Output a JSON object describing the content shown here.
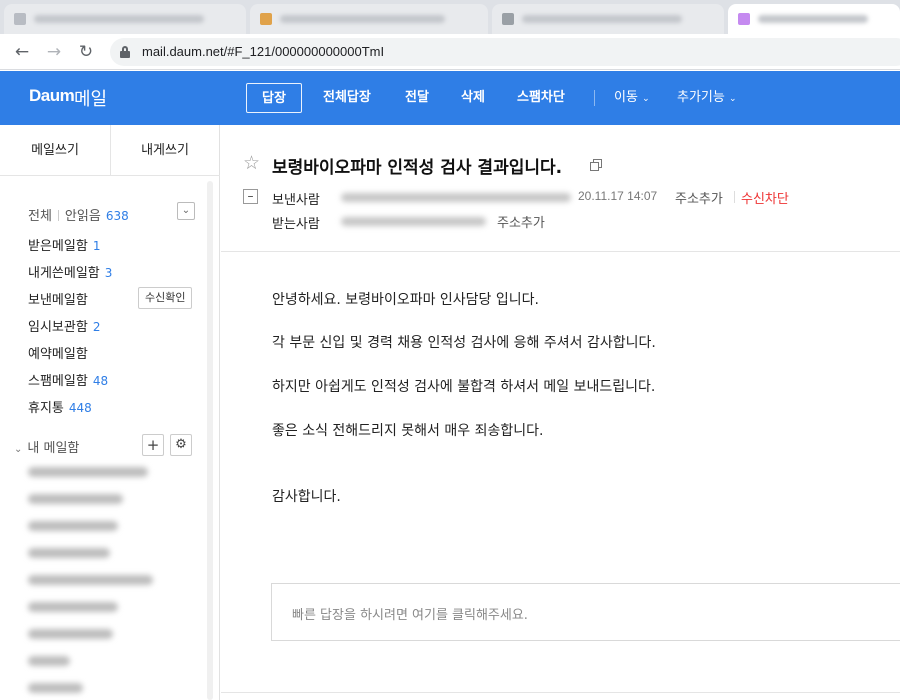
{
  "browser": {
    "url": "mail.daum.net/#F_121/000000000000TmI"
  },
  "app": {
    "logo": "Daum",
    "service": "메일",
    "brand_color": "#2f7ee6"
  },
  "toolbar": {
    "reply": "답장",
    "reply_all": "전체답장",
    "forward": "전달",
    "delete": "삭제",
    "block_spam": "스팸차단",
    "move": "이동",
    "more": "추가기능"
  },
  "sidebar": {
    "compose": "메일쓰기",
    "compose_self": "내게쓰기",
    "all_label": "전체",
    "unread_label": "안읽음",
    "unread_count": "638",
    "folders": [
      {
        "label": "받은메일함",
        "count": "1"
      },
      {
        "label": "내게쓴메일함",
        "count": "3"
      },
      {
        "label": "보낸메일함",
        "count": ""
      },
      {
        "label": "임시보관함",
        "count": "2"
      },
      {
        "label": "예약메일함",
        "count": ""
      },
      {
        "label": "스팸메일함",
        "count": "48"
      },
      {
        "label": "휴지통",
        "count": "448"
      }
    ],
    "read_receipt_button": "수신확인",
    "my_mailbox": "내 메일함"
  },
  "message": {
    "subject": "보령바이오파마 인적성 검사 결과입니다.",
    "sender_label": "보낸사람",
    "recipient_label": "받는사람",
    "date": "20.11.17 14:07",
    "add_address": "주소추가",
    "block_sender": "수신차단",
    "body": [
      "안녕하세요. 보령바이오파마 인사담당 입니다.",
      "각 부문 신입 및 경력 채용 인적성 검사에 응해 주셔서 감사합니다.",
      "하지만 아쉽게도 인적성 검사에 불합격 하셔서 메일 보내드립니다.",
      "좋은 소식 전해드리지 못해서 매우 죄송합니다.",
      "감사합니다."
    ],
    "quick_reply_placeholder": "빠른 답장을 하시려면 여기를 클릭해주세요."
  }
}
